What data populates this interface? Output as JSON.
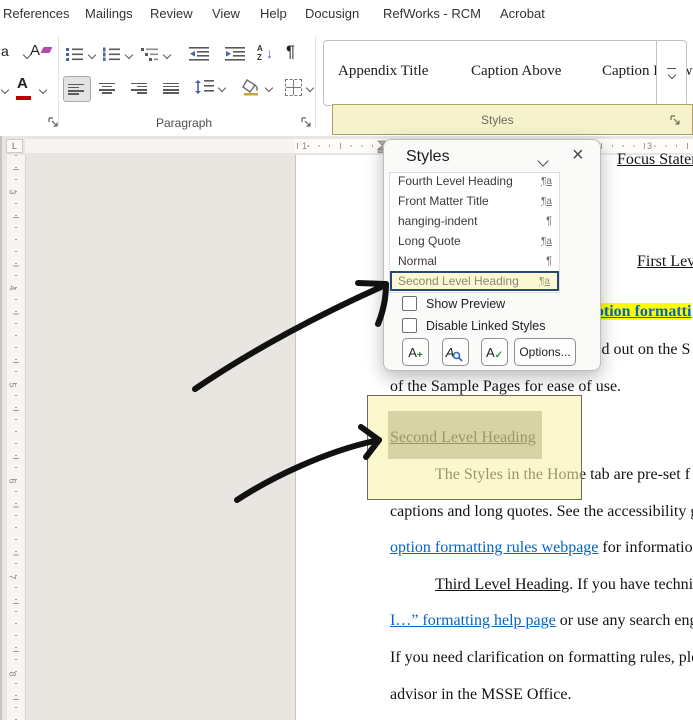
{
  "ribbon": {
    "tabs": [
      "References",
      "Mailings",
      "Review",
      "View",
      "Help",
      "Docusign",
      "RefWorks - RCM",
      "Acrobat"
    ],
    "paragraph_group_label": "Paragraph",
    "styles_group_label": "Styles",
    "gallery_items": [
      "Appendix Title",
      "Caption Above",
      "Caption Below"
    ]
  },
  "icons": {
    "pilcrow": "¶",
    "letter_a_lower": "a",
    "letter_A": "A",
    "sort_A": "A",
    "sort_Z": "Z",
    "down_arrow": "↓",
    "close": "×",
    "plus": "+",
    "check": "✓"
  },
  "styles_pane": {
    "title": "Styles",
    "items": [
      {
        "name": "Fourth Level Heading",
        "icon": "¶a"
      },
      {
        "name": "Front Matter Title",
        "icon": "¶a"
      },
      {
        "name": "hanging-indent",
        "icon": "¶"
      },
      {
        "name": "Long Quote",
        "icon": "¶a"
      },
      {
        "name": "Normal",
        "icon": "¶"
      },
      {
        "name": "Second Level Heading",
        "icon": "¶a"
      }
    ],
    "selected_item": "Second Level Heading",
    "show_preview_label": "Show Preview",
    "disable_linked_label": "Disable Linked Styles",
    "options_label": "Options..."
  },
  "document": {
    "lines": {
      "focus_heading": "Focus Statem",
      "first_level": "First Leve",
      "highlight_link": "ption formatti",
      "laid_out": "id out on the S",
      "sample_pages": "of the Sample Pages for ease of use.",
      "second_level_heading": "Second Level Heading",
      "styles_home": "The Styles in the Home tab are pre-set f",
      "captions": "captions and long quotes. See the accessibility g",
      "option_link": "option formatting rules webpage",
      "option_rest": " for informatio",
      "third_heading": "Third Level Heading",
      "third_rest": ". If you have techni",
      "help_link": "I…” formatting help page",
      "help_rest": " or use any search eng",
      "clarification": "If you need clarification on formatting rules, ple",
      "advisor": "advisor in the MSSE Office."
    }
  },
  "rulers": {
    "tab_selector": "L",
    "h_numbers": [
      {
        "label": "1"
      },
      {
        "label": "3"
      }
    ],
    "v_numbers": [
      "3",
      "4",
      "5",
      "6",
      "7",
      "8"
    ]
  },
  "colors": {
    "selection_border": "#234a77",
    "selected_row_bg": "#fcf7d5",
    "link_blue": "#0563C1",
    "highlight_yellow": "#ffff00",
    "callout_yellow": "#faf3aa",
    "styles_bar_yellow": "#f6f2cc",
    "arrow_black": "#111111"
  }
}
